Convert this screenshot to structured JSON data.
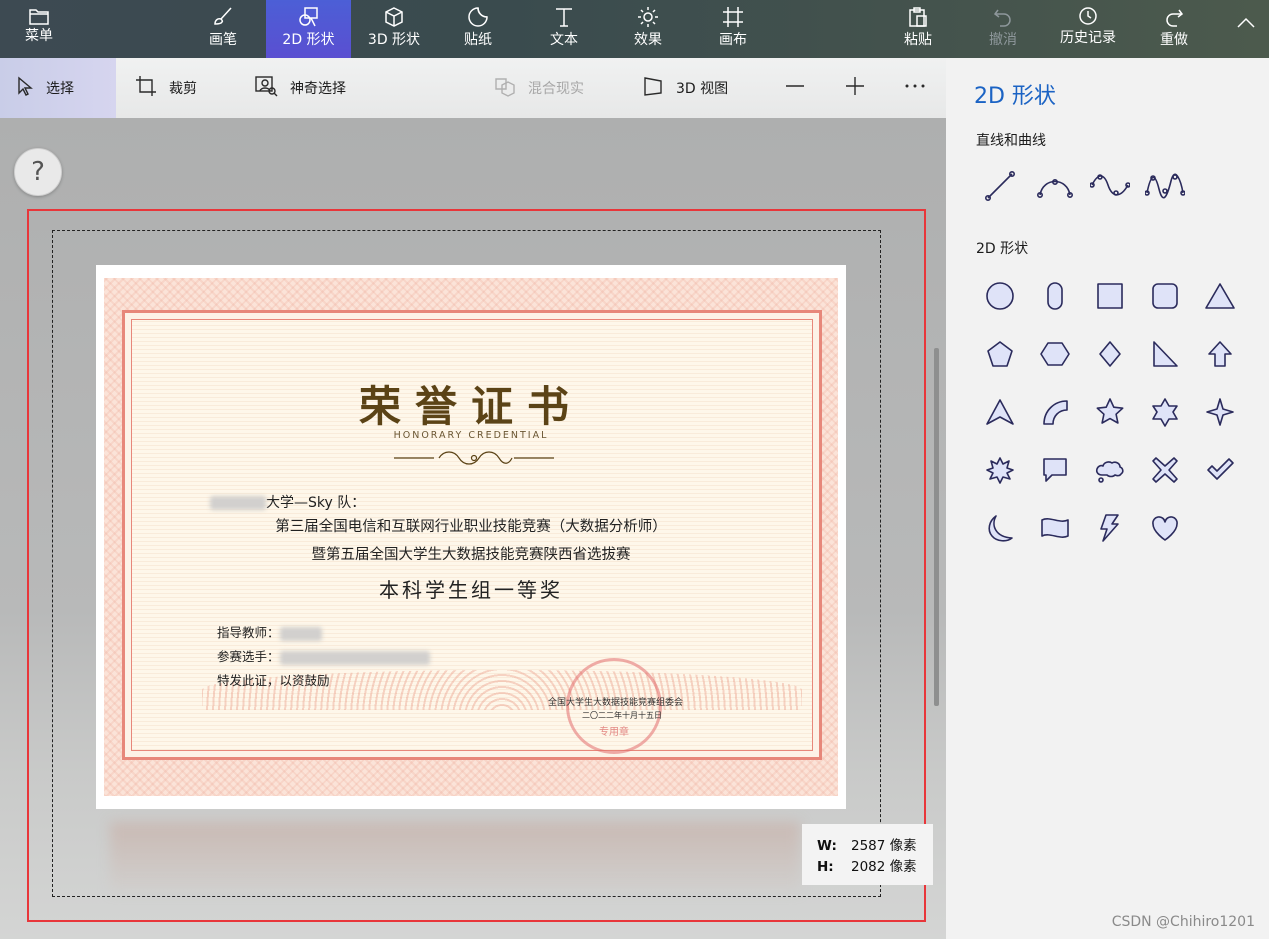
{
  "ribbon": {
    "menu": "菜单",
    "tools": [
      {
        "id": "brush",
        "label": "画笔"
      },
      {
        "id": "shapes2d",
        "label": "2D 形状",
        "active": true
      },
      {
        "id": "shapes3d",
        "label": "3D 形状"
      },
      {
        "id": "stickers",
        "label": "贴纸"
      },
      {
        "id": "text",
        "label": "文本"
      },
      {
        "id": "effects",
        "label": "效果"
      },
      {
        "id": "canvas",
        "label": "画布"
      }
    ],
    "right": [
      {
        "id": "paste",
        "label": "粘贴"
      },
      {
        "id": "undo",
        "label": "撤消",
        "disabled": true
      },
      {
        "id": "history",
        "label": "历史记录"
      },
      {
        "id": "redo",
        "label": "重做"
      }
    ]
  },
  "subbar": {
    "select": "选择",
    "crop": "裁剪",
    "magic_select": "神奇选择",
    "mixed_reality": "混合现实",
    "view3d": "3D 视图"
  },
  "help": "?",
  "size": {
    "w_label": "W:",
    "w_value": "2587 像素",
    "h_label": "H:",
    "h_value": "2082 像素"
  },
  "certificate": {
    "title": "荣誉证书",
    "subtitle": "HONORARY CREDENTIAL",
    "team": "大学—Sky 队：",
    "line1": "第三届全国电信和互联网行业职业技能竞赛（大数据分析师）",
    "line2": "暨第五届全国大学生大数据技能竞赛陕西省选拔赛",
    "award": "本科学生组一等奖",
    "teacher_label": "指导教师：",
    "players_label": "参赛选手：",
    "closing": "特发此证，以资鼓励",
    "issuer": "全国大学生大数据技能竞赛组委会",
    "date": "二〇二二年十月十五日",
    "seal_text": "专用章"
  },
  "panel": {
    "title": "2D 形状",
    "lines_section": "直线和曲线",
    "shapes_section": "2D 形状",
    "accent": "#1b63c4"
  },
  "watermark": "CSDN @Chihiro1201"
}
